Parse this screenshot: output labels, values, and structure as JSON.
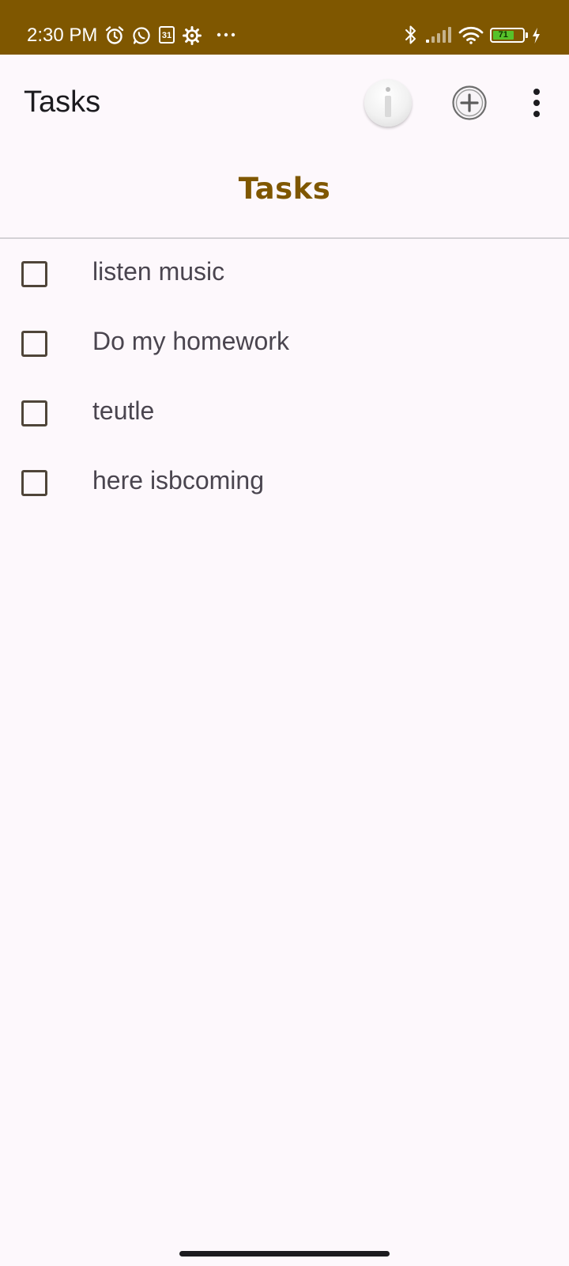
{
  "status_bar": {
    "time": "2:30 PM",
    "background_color": "#7f5700",
    "left_icons": [
      "alarm-icon",
      "whatsapp-icon",
      "calendar-icon",
      "settings-gear-icon",
      "more-notifications-icon"
    ],
    "calendar_day": "31",
    "right_icons": [
      "bluetooth-icon",
      "cell-signal-icon",
      "wifi-icon",
      "battery-icon",
      "charging-icon"
    ],
    "battery_level": "71"
  },
  "app_bar": {
    "title": "Tasks",
    "actions": [
      {
        "name": "info-button",
        "icon": "info-icon"
      },
      {
        "name": "add-task-button",
        "icon": "add-circle-icon"
      },
      {
        "name": "overflow-menu-button",
        "icon": "more-vert-icon"
      }
    ]
  },
  "page": {
    "heading": "Tasks",
    "heading_color": "#7f5700"
  },
  "tasks": [
    {
      "label": "listen music",
      "checked": false
    },
    {
      "label": "Do my homework",
      "checked": false
    },
    {
      "label": "teutle",
      "checked": false
    },
    {
      "label": "here isbcoming",
      "checked": false
    }
  ]
}
